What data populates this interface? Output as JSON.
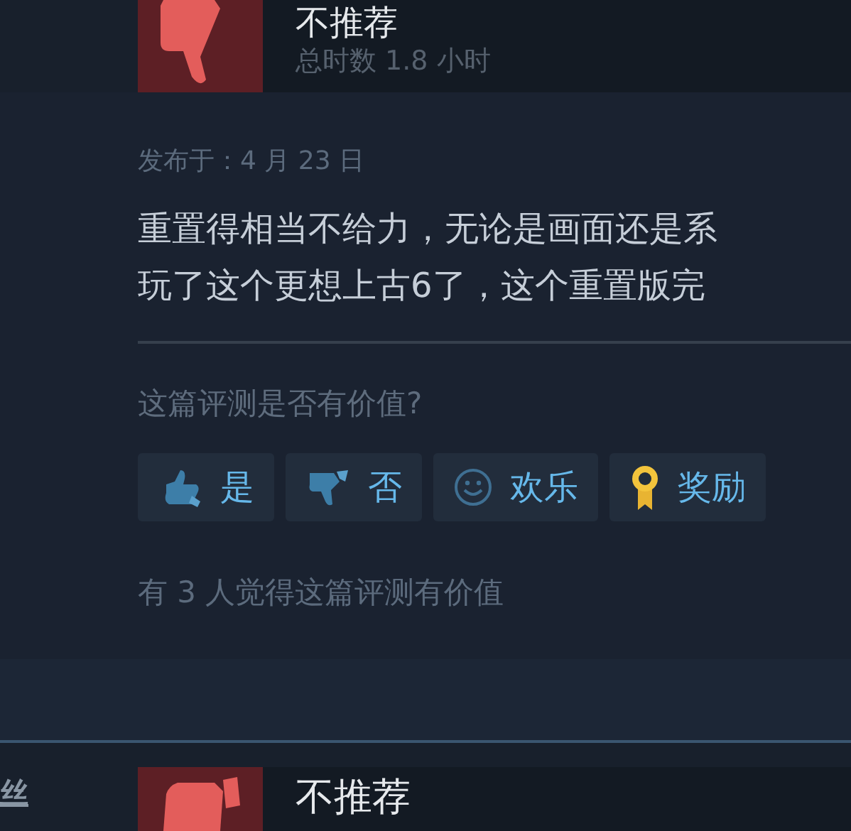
{
  "review": {
    "verdict": "不推荐",
    "playtime": "总时数 1.8 小时",
    "posted": "发布于：4 月 23 日",
    "text_lines": [
      "重置得相当不给力，无论是画面还是系",
      "玩了这个更想上古6了，这个重置版完"
    ],
    "helpful_prompt": "这篇评测是否有价值?",
    "buttons": [
      {
        "kind": "thumb-up",
        "label": "是"
      },
      {
        "kind": "thumb-down",
        "label": "否"
      },
      {
        "kind": "smile",
        "label": "欢乐"
      },
      {
        "kind": "award",
        "label": "奖励"
      }
    ],
    "helpful_count": "有 3 人觉得这篇评测有价值"
  },
  "next_review": {
    "author_fragment": "丝",
    "verdict": "不推荐"
  }
}
